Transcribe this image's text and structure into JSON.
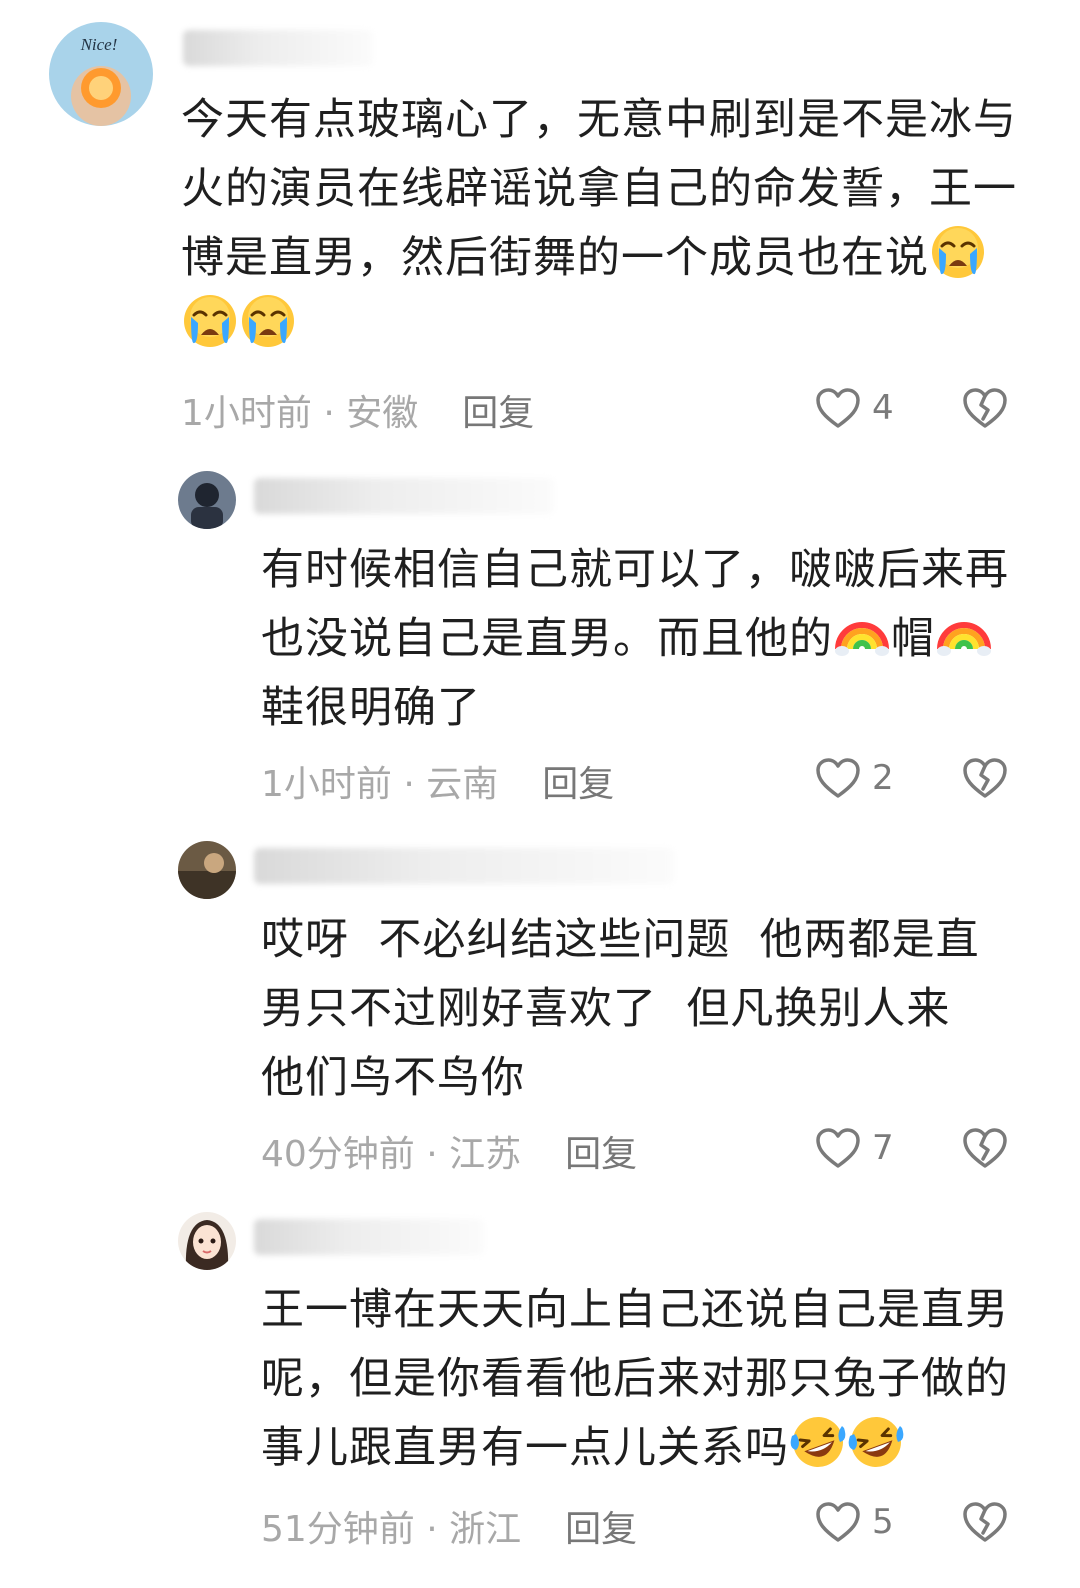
{
  "comments": [
    {
      "username": "彩虹",
      "text_parts": [
        "今天有点玻璃心了，无意中刷到是不是冰与火的演员在线辟谣说拿自己的命发誓，王一博是直男，然后街舞的一个成员也在说"
      ],
      "emoji_tail": [
        "crying",
        "crying",
        "crying"
      ],
      "time": "1小时前",
      "location": "安徽",
      "separator": " · ",
      "reply_label": "回复",
      "likes": "4"
    },
    {
      "username": "",
      "text_a": "有时候相信自己就可以了，啵啵后来再也没说自己是直男。而且他的",
      "text_b": "帽",
      "text_c": "鞋很明确了",
      "time": "1小时前",
      "location": "云南",
      "separator": " · ",
      "reply_label": "回复",
      "likes": "2"
    },
    {
      "username": "",
      "text": "哎呀  不必纠结这些问题  他两都是直男只不过刚好喜欢了  但凡换别人来  他们鸟不鸟你",
      "time": "40分钟前",
      "location": "江苏",
      "separator": " · ",
      "reply_label": "回复",
      "likes": "7"
    },
    {
      "username": "",
      "text": "王一博在天天向上自己还说自己是直男呢，但是你看看他后来对那只兔子做的事儿跟直男有一点儿关系吗",
      "time": "51分钟前",
      "location": "浙江",
      "separator": " · ",
      "reply_label": "回复",
      "likes": "5"
    }
  ],
  "avatar1_text": "Nice!",
  "icons": {
    "like": "heart-outline-icon",
    "dislike": "broken-heart-icon",
    "emoji_crying": "loudly-crying-face",
    "emoji_rainbow": "rainbow",
    "emoji_laughing": "rolling-laughing-face"
  },
  "colors": {
    "text": "#1f1f1f",
    "meta": "#a8a8a8",
    "reply": "#777777",
    "icon": "#7a7a7a"
  }
}
